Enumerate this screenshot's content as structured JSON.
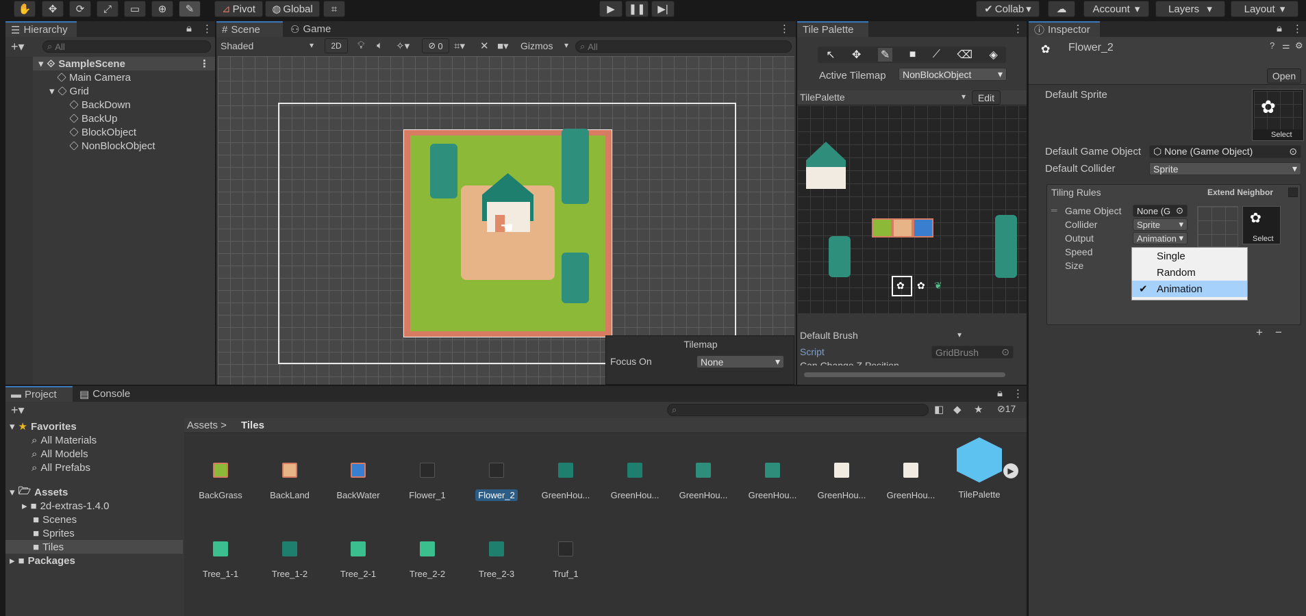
{
  "toolbar": {
    "tools": [
      "hand-icon",
      "move-icon",
      "rotate-icon",
      "scale-icon",
      "rect-icon",
      "transform-icon",
      "brush-icon"
    ],
    "pivot": "Pivot",
    "global": "Global",
    "collab": "Collab",
    "account": "Account",
    "layers": "Layers",
    "layout": "Layout"
  },
  "hierarchy": {
    "tab": "Hierarchy",
    "search_placeholder": "All",
    "scene": "SampleScene",
    "items": [
      "Main Camera",
      "Grid",
      "BackDown",
      "BackUp",
      "BlockObject",
      "NonBlockObject"
    ]
  },
  "scene": {
    "tab_scene": "Scene",
    "tab_game": "Game",
    "shading": "Shaded",
    "mode2d": "2D",
    "hidden_count": "0",
    "gizmos": "Gizmos",
    "search_placeholder": "All",
    "overlay_title": "Tilemap",
    "focus_label": "Focus On",
    "focus_value": "None"
  },
  "palette": {
    "tab": "Tile Palette",
    "active_tilemap_label": "Active Tilemap",
    "active_tilemap": "NonBlockObject",
    "palette_name": "TilePalette",
    "edit": "Edit",
    "brush": "Default Brush",
    "script_label": "Script",
    "script_value": "GridBrush",
    "flood_label": "Can Change Z Position"
  },
  "inspector": {
    "tab": "Inspector",
    "object_name": "Flower_2",
    "open": "Open",
    "default_sprite": "Default Sprite",
    "select": "Select",
    "default_go_label": "Default Game Object",
    "default_go_value": "None (Game Object)",
    "default_collider_label": "Default Collider",
    "default_collider_value": "Sprite",
    "tiling_rules": "Tiling Rules",
    "extend_neighbor": "Extend Neighbor",
    "rule_go_label": "Game Object",
    "rule_go_value": "None (G",
    "rule_collider_label": "Collider",
    "rule_collider_value": "Sprite",
    "rule_output_label": "Output",
    "rule_output_value": "Animation",
    "speed_label": "Speed",
    "size_label": "Size",
    "menu": [
      "Single",
      "Random",
      "Animation"
    ],
    "menu_selected": "Animation"
  },
  "project": {
    "tab_project": "Project",
    "tab_console": "Console",
    "hidden_count": "17",
    "favorites": "Favorites",
    "fav_items": [
      "All Materials",
      "All Models",
      "All Prefabs"
    ],
    "assets": "Assets",
    "asset_folders": [
      "2d-extras-1.4.0",
      "Scenes",
      "Sprites",
      "Tiles"
    ],
    "packages": "Packages",
    "breadcrumb_root": "Assets",
    "breadcrumb_current": "Tiles",
    "row1": [
      "BackGrass",
      "BackLand",
      "BackWater",
      "Flower_1",
      "Flower_2",
      "GreenHou...",
      "GreenHou...",
      "GreenHou...",
      "GreenHou...",
      "GreenHou...",
      "GreenHou...",
      "TilePalette"
    ],
    "row2": [
      "Tree_1-1",
      "Tree_1-2",
      "Tree_2-1",
      "Tree_2-2",
      "Tree_2-3",
      "Truf_1"
    ],
    "selected_asset": "Flower_2"
  },
  "colors": {
    "accent": "#3a79bb",
    "grass": "#8fbf3a",
    "dirt": "#e9b98a",
    "tree": "#2d8f7c",
    "selection": "#2c5d87"
  }
}
